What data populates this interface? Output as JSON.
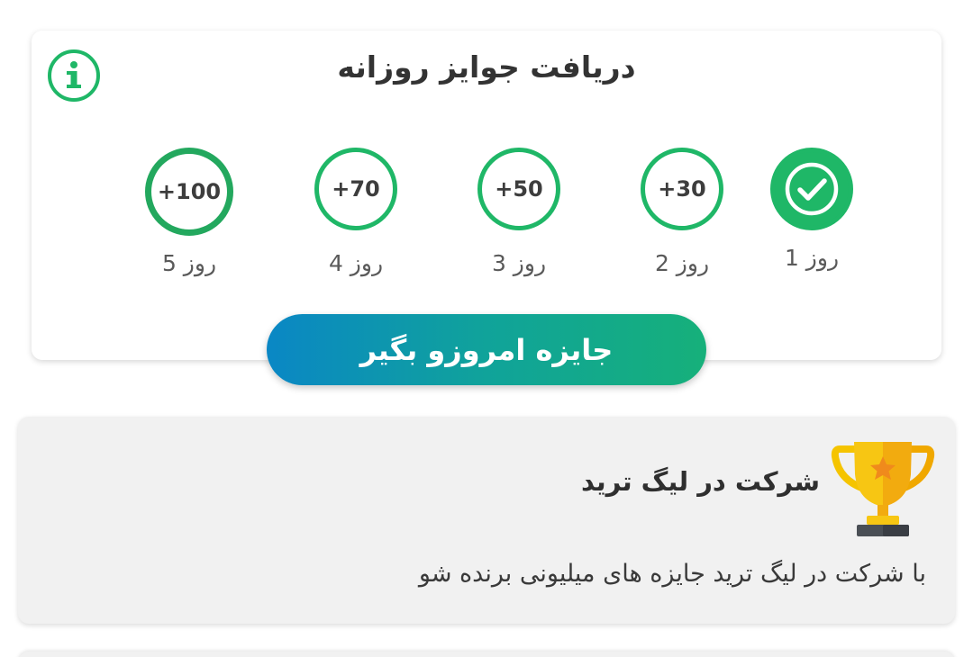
{
  "daily_rewards": {
    "title": "دریافت جوایز روزانه",
    "info_icon": "info-icon",
    "days": [
      {
        "label": "روز 1",
        "reward": "",
        "claimed": true,
        "icon": "check-icon"
      },
      {
        "label": "روز 2",
        "reward": "+30",
        "claimed": false
      },
      {
        "label": "روز 3",
        "reward": "+50",
        "claimed": false
      },
      {
        "label": "روز 4",
        "reward": "+70",
        "claimed": false
      },
      {
        "label": "روز 5",
        "reward": "+100",
        "claimed": false
      }
    ],
    "claim_button_label": "جایزه امروزو بگیر"
  },
  "league_card": {
    "icon": "trophy-icon",
    "title": "شرکت در لیگ ترید",
    "description": "با شرکت در لیگ ترید جایزه های میلیونی برنده شو"
  },
  "colors": {
    "accent_green": "#1fb767",
    "button_gradient_start": "#0a87c5",
    "button_gradient_end": "#16b07a",
    "card_gray": "#f1f1f1"
  }
}
